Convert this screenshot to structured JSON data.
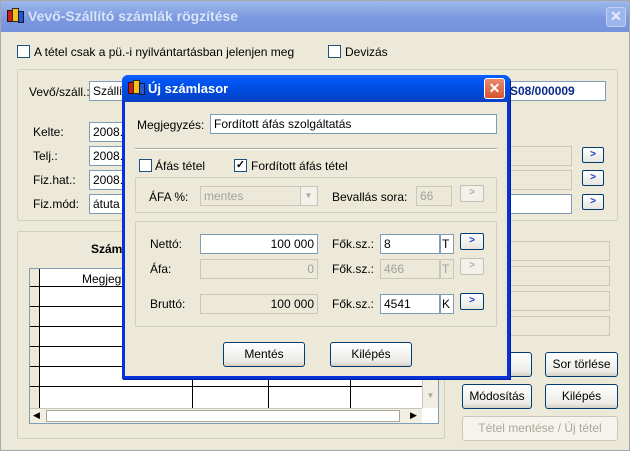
{
  "main_window": {
    "title": "Vevő-Szállító számlák rögzítése",
    "close_glyph": "✕",
    "checkbox_pu_label": "A tétel csak a pü.-i nyilvántartásban jelenjen meg",
    "checkbox_devizas_label": "Devizás",
    "vevo_label": "Vevő/száll.:",
    "vevo_value": "Szállí",
    "doc_number": "S08/000009",
    "kelte_label": "Kelte:",
    "kelte_value": "2008.",
    "telj_label": "Telj.:",
    "telj_value": "2008.",
    "fizhat_label": "Fiz.hat.:",
    "fizhat_value": "2008.",
    "fizmod_label": "Fiz.mód:",
    "fizmod_value": "átuta",
    "grid_section_label": "Szám",
    "grid_column_header": "Megjeg",
    "arrow_glyph": ">",
    "buttons": {
      "sor_torlese": "Sor törlése",
      "modositas": "Módosítás",
      "kilepes": "Kilépés",
      "tetel_mentese": "Tétel mentése / Új tétel"
    }
  },
  "dialog": {
    "title": "Új számlasor",
    "close_glyph": "✕",
    "megjegyzes_label": "Megjegyzés:",
    "megjegyzes_value": "Fordított áfás szolgáltatás",
    "afas_tetel_label": "Áfás tétel",
    "afas_tetel_checked": false,
    "forditott_label": "Fordított áfás tétel",
    "forditott_checked": true,
    "check_glyph": "✓",
    "afa_pct_label": "ÁFA %:",
    "afa_pct_value": "mentes",
    "bevallas_label": "Bevallás sora:",
    "bevallas_value": "66",
    "netto_label": "Nettó:",
    "netto_value": "100 000",
    "netto_fok_label": "Fők.sz.:",
    "netto_fok_value": "8",
    "netto_fok_flag": "T",
    "afa_label": "Áfa:",
    "afa_value": "0",
    "afa_fok_label": "Fők.sz.:",
    "afa_fok_value": "466",
    "afa_fok_flag": "T",
    "brutto_label": "Bruttó:",
    "brutto_value": "100 000",
    "brutto_fok_label": "Fők.sz.:",
    "brutto_fok_value": "4541",
    "brutto_fok_flag": "K",
    "arrow_glyph": ">",
    "combo_arrow_glyph": "▼",
    "mentes_button": "Mentés",
    "kilepes_button": "Kilépés"
  }
}
